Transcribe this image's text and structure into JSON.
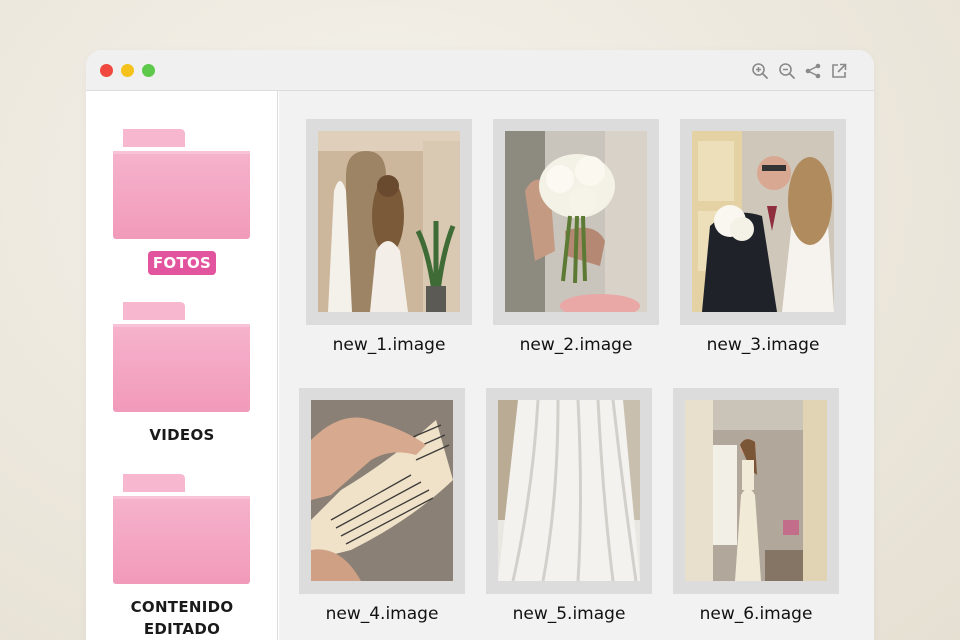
{
  "window": {
    "controls": [
      "close",
      "minimize",
      "maximize"
    ],
    "toolbar_icons": [
      "zoom-in-icon",
      "zoom-out-icon",
      "share-icon",
      "open-external-icon"
    ]
  },
  "sidebar": {
    "folders": [
      {
        "label": "FOTOS",
        "active": true
      },
      {
        "label": "VIDEOS",
        "active": false
      },
      {
        "label": "CONTENIDO",
        "label_line2": "EDITADO",
        "active": false
      }
    ]
  },
  "files": [
    {
      "name": "new_1.image"
    },
    {
      "name": "new_2.image"
    },
    {
      "name": "new_3.image"
    },
    {
      "name": "new_4.image"
    },
    {
      "name": "new_5.image"
    },
    {
      "name": "new_6.image"
    }
  ],
  "colors": {
    "accent": "#e2549d",
    "folder": "#f3a3c2",
    "close": "#f0483e",
    "minimize": "#f5c21b",
    "maximize": "#5dc94b"
  }
}
